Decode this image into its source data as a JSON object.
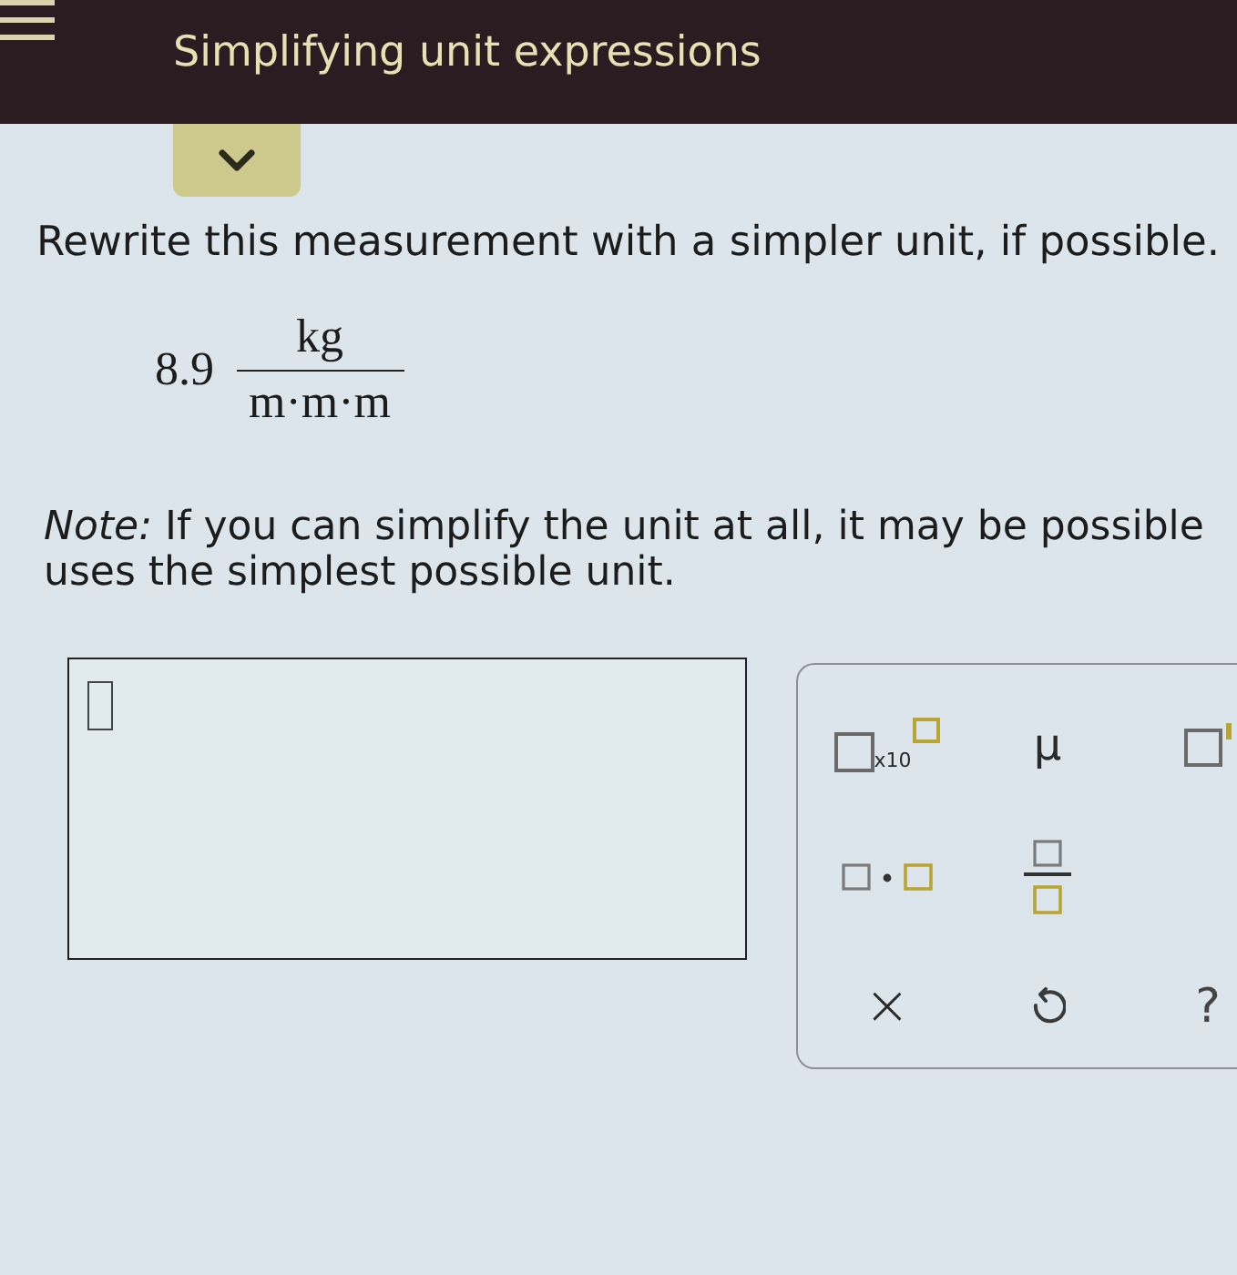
{
  "header": {
    "title": "Simplifying unit expressions"
  },
  "question": {
    "prompt": "Rewrite this measurement with a simpler unit, if possible.",
    "expression": {
      "value": "8.9",
      "numerator": "kg",
      "denominator": "m·m·m"
    },
    "note_lines": [
      "*Note:* If you can simplify the unit at all, it may be possible",
      "uses the simplest possible unit."
    ]
  },
  "keypad": {
    "keys": [
      {
        "kind": "scientific",
        "label": "x10"
      },
      {
        "kind": "symbol",
        "label": "μ"
      },
      {
        "kind": "superscript"
      },
      {
        "kind": "product"
      },
      {
        "kind": "fraction"
      },
      {
        "kind": "clear",
        "label": "×"
      },
      {
        "kind": "undo"
      },
      {
        "kind": "help",
        "label": "?"
      }
    ]
  }
}
